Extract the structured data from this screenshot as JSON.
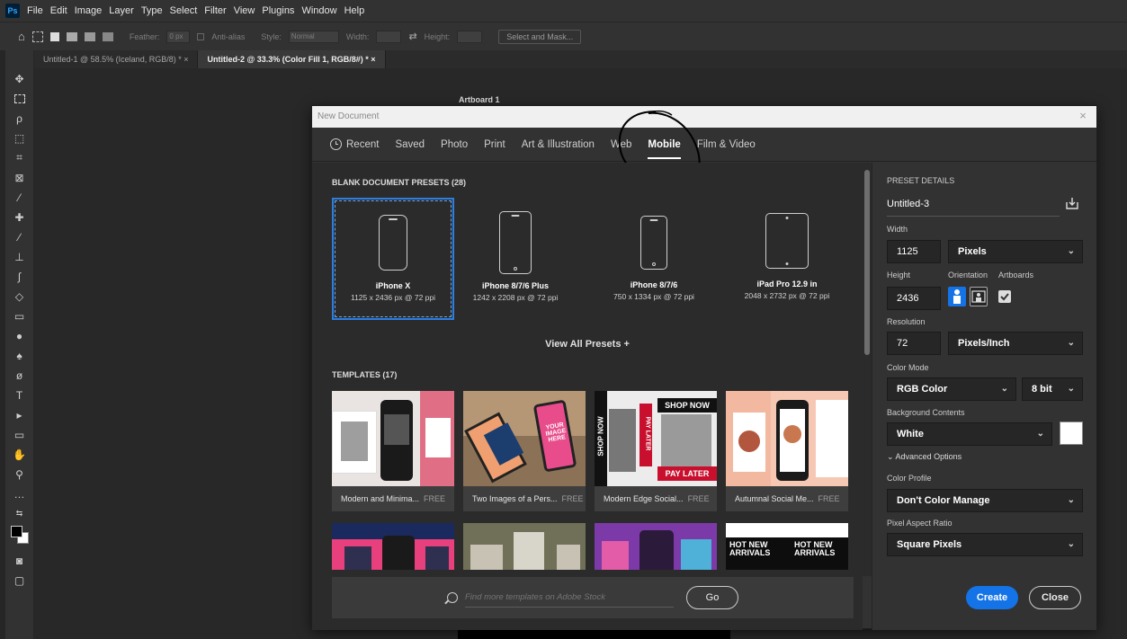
{
  "app": {
    "logo": "Ps"
  },
  "menubar": [
    "File",
    "Edit",
    "Image",
    "Layer",
    "Type",
    "Select",
    "Filter",
    "View",
    "Plugins",
    "Window",
    "Help"
  ],
  "options": {
    "feather_label": "Feather:",
    "feather_value": "0 px",
    "antialias_label": "Anti-alias",
    "style_label": "Style:",
    "style_value": "Normal",
    "width_label": "Width:",
    "height_label": "Height:",
    "select_mask": "Select and Mask..."
  },
  "doc_tabs": [
    {
      "label": "Untitled-1 @ 58.5% (Iceland, RGB/8) * ×"
    },
    {
      "label": "Untitled-2 @ 33.3% (Color Fill 1, RGB/8#) * ×"
    }
  ],
  "artboard_label": "Artboard 1",
  "dialog": {
    "title": "New Document",
    "close_glyph": "×",
    "tabs": [
      "Recent",
      "Saved",
      "Photo",
      "Print",
      "Art & Illustration",
      "Web",
      "Mobile",
      "Film & Video"
    ],
    "active_tab": "Mobile",
    "presets_title": "BLANK DOCUMENT PRESETS  (28)",
    "presets": [
      {
        "name": "iPhone X",
        "size": "1125 x 2436 px @ 72 ppi"
      },
      {
        "name": "iPhone 8/7/6 Plus",
        "size": "1242 x 2208 px @ 72 ppi"
      },
      {
        "name": "iPhone 8/7/6",
        "size": "750 x 1334 px @ 72 ppi"
      },
      {
        "name": "iPad Pro 12.9 in",
        "size": "2048 x 2732 px @ 72 ppi"
      }
    ],
    "view_all": "View All Presets +",
    "templates_title": "TEMPLATES  (17)",
    "templates": [
      {
        "name": "Modern and Minima...",
        "tag": "FREE"
      },
      {
        "name": "Two Images of a Pers...",
        "tag": "FREE"
      },
      {
        "name": "Modern Edge Social...",
        "tag": "FREE"
      },
      {
        "name": "Autumnal Social Me...",
        "tag": "FREE"
      }
    ],
    "template_text": {
      "shop_now": "SHOP NOW",
      "pay_later": "PAY LATER",
      "your_image_here": "YOUR IMAGE HERE",
      "hot_new": "HOT NEW",
      "arrivals": "ARRIVALS"
    },
    "stock_placeholder": "Find more templates on Adobe Stock",
    "go": "Go",
    "details": {
      "title": "PRESET DETAILS",
      "doc_name": "Untitled-3",
      "width_label": "Width",
      "width_value": "1125",
      "width_unit": "Pixels",
      "height_label": "Height",
      "height_value": "2436",
      "orientation_label": "Orientation",
      "artboards_label": "Artboards",
      "resolution_label": "Resolution",
      "resolution_value": "72",
      "resolution_unit": "Pixels/Inch",
      "color_mode_label": "Color Mode",
      "color_mode": "RGB Color",
      "bit_depth": "8 bit",
      "background_label": "Background Contents",
      "background": "White",
      "advanced": "Advanced Options",
      "color_profile_label": "Color Profile",
      "color_profile": "Don't Color Manage",
      "pixel_aspect_label": "Pixel Aspect Ratio",
      "pixel_aspect": "Square Pixels",
      "create": "Create",
      "close": "Close"
    }
  },
  "colors": {
    "accent": "#1473e6",
    "selection": "#2c7ee0",
    "dialog_bg": "#323232"
  }
}
